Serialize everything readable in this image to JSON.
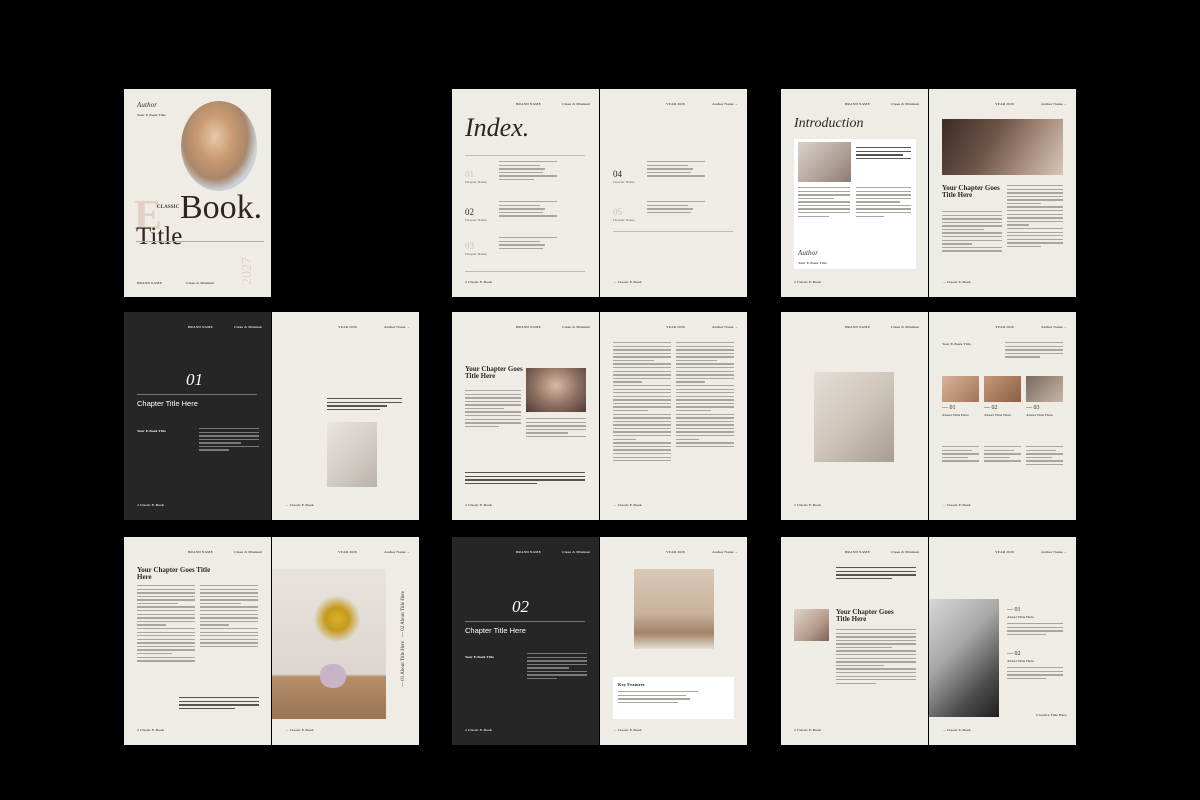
{
  "cover": {
    "author_script": "Author",
    "subtitle": "Your E-Book Title",
    "big_letter": "E",
    "classic": "CLASSIC",
    "book": "Book.",
    "title": "Title",
    "year": "2027",
    "brand": "BRAND NAME",
    "tagline": "Clean & Minimal"
  },
  "header": {
    "brand": "BRAND NAME",
    "tagline": "Clean & Minimal",
    "year": "YEAR 2028",
    "author": "Author Name →"
  },
  "footer": {
    "classic": "→ Classic E-Book",
    "page2": "2 Classic E-Book"
  },
  "index": {
    "title": "Index.",
    "chapters": [
      {
        "num": "01",
        "name": "Chapter Name"
      },
      {
        "num": "02",
        "name": "Chapter Name"
      },
      {
        "num": "03",
        "name": "Chapter Name"
      },
      {
        "num": "04",
        "name": "Chapter Name"
      },
      {
        "num": "05",
        "name": "Chapter Name"
      }
    ]
  },
  "intro": {
    "title": "Introduction",
    "author_script": "Author",
    "subtitle": "Your E-Book Title",
    "chapter_title": "Your Chapter Goes Title Here"
  },
  "chapter1": {
    "num": "01",
    "title": "Chapter Title Here",
    "ebook": "Your E-Book Title"
  },
  "chapter2": {
    "num": "02",
    "title": "Chapter Title Here",
    "ebook": "Your E-Book Title",
    "key_features": "Key Features"
  },
  "spread_chapter": {
    "title": "Your Chapter Goes Title Here"
  },
  "gallery": {
    "heading": "Your E-Book Title",
    "items": [
      {
        "num": "— 01",
        "label": "About Title Here"
      },
      {
        "num": "— 02",
        "label": "About Title Here"
      },
      {
        "num": "— 03",
        "label": "About Title Here"
      }
    ]
  },
  "last": {
    "chapter_title": "Your Chapter Goes Title Here",
    "item1_num": "— 01",
    "item1_label": "About Title Here",
    "item2_num": "— 02",
    "item2_label": "About Title Here",
    "creative": "Creative Title Here"
  },
  "vertical": {
    "v1": "— 01 About Title Here",
    "v2": "— 02 About Title Here"
  }
}
